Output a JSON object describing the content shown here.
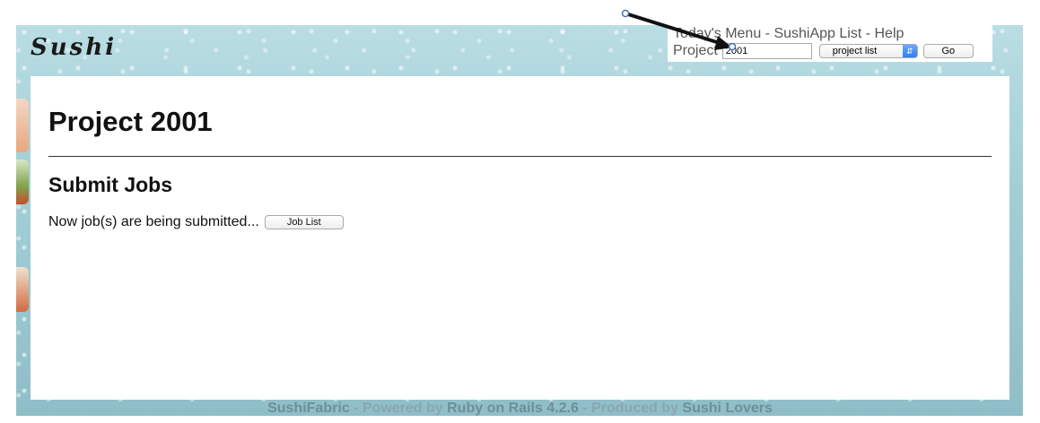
{
  "logo": {
    "text": "Sushi"
  },
  "nav": {
    "todays_menu": "Today's Menu",
    "sep1": " - ",
    "sushiapp_list": "SushiApp List",
    "sep2": " - ",
    "help": "Help"
  },
  "project_selector": {
    "label": "Project",
    "input_value": "2001",
    "select_value": "project list",
    "go_label": "Go"
  },
  "page": {
    "title": "Project 2001",
    "section_title": "Submit Jobs",
    "status_text": "Now job(s) are being submitted...",
    "job_list_label": "Job List"
  },
  "footer": {
    "app": "SushiFabric",
    "powered_by": " - Powered by ",
    "framework": "Ruby on Rails 4.2.6",
    "produced_by": " - Produced by ",
    "team": "Sushi Lovers"
  },
  "colors": {
    "frame_bg": "#a4cfd7",
    "nav_text": "#555555",
    "accent_blue": "#2f7ef5"
  }
}
